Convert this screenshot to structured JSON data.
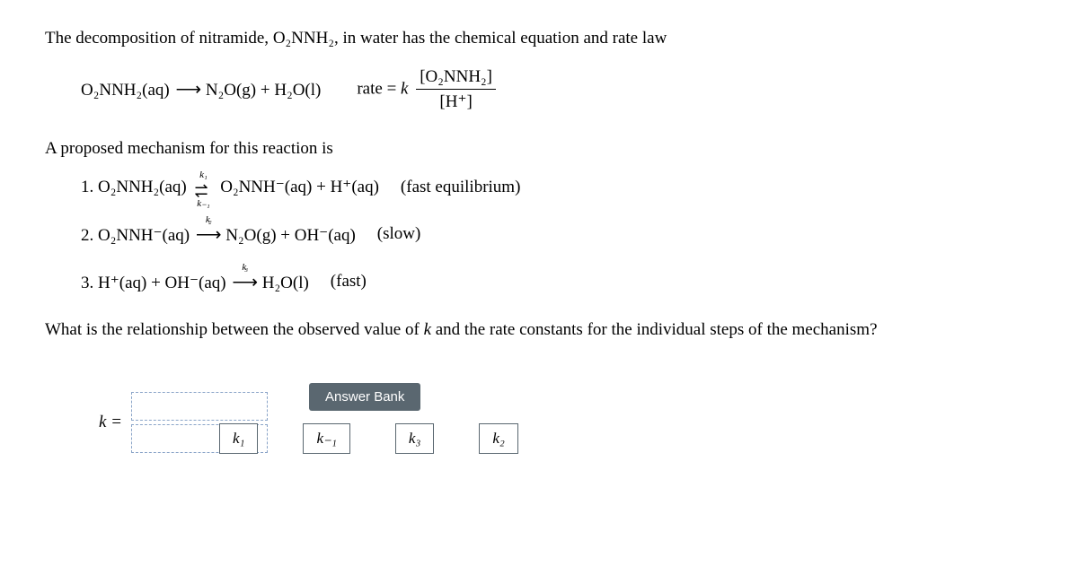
{
  "intro": {
    "prefix": "The decomposition of nitramide, ",
    "species": "O₂NNH₂",
    "suffix": ", in water has the chemical equation and rate law"
  },
  "overall": {
    "lhs": "O₂NNH₂(aq)",
    "arrow": "⟶",
    "rhs": "N₂O(g) + H₂O(l)",
    "rate_label": "rate = ",
    "rate_k": "k",
    "rate_num": "[O₂NNH₂]",
    "rate_den": "[H⁺]"
  },
  "mech_intro": "A proposed mechanism for this reaction is",
  "steps": [
    {
      "num": "1. ",
      "lhs": "O₂NNH₂(aq)",
      "k_top": "k₁",
      "k_bot": "k₋₁",
      "rhs": "O₂NNH⁻(aq) + H⁺(aq)",
      "note": "(fast equilibrium)"
    },
    {
      "num": "2. ",
      "lhs": "O₂NNH⁻(aq)",
      "k_top": "k₂",
      "rhs": "N₂O(g) + OH⁻(aq)",
      "note": "(slow)"
    },
    {
      "num": "3. ",
      "lhs": "H⁺(aq) + OH⁻(aq)",
      "k_top": "k₃",
      "rhs": "H₂O(l)",
      "note": "(fast)"
    }
  ],
  "question": {
    "p1": "What is the relationship between the observed value of ",
    "kvar": "k",
    "p2": " and the rate constants for the individual steps of the mechanism?"
  },
  "answer": {
    "k_label": "k =",
    "bank_title": "Answer Bank",
    "items": [
      "k₁",
      "k₋₁",
      "k₃",
      "k₂"
    ]
  }
}
